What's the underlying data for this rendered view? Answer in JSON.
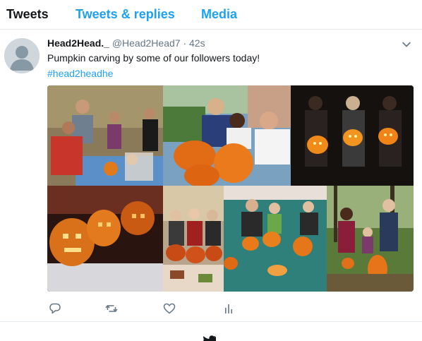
{
  "tabs": {
    "tweets": "Tweets",
    "replies": "Tweets & replies",
    "media": "Media"
  },
  "tweet": {
    "name": "Head2Head._",
    "handle": "@Head2Head7",
    "separator": "·",
    "time": "42s",
    "text": "Pumpkin carving by some of our followers today!",
    "hashtag": "#head2headhe"
  },
  "icons": {
    "avatar": "default-user-icon",
    "menu": "chevron-down-icon",
    "reply": "reply-icon",
    "retweet": "retweet-icon",
    "like": "heart-icon",
    "analytics": "analytics-icon",
    "footer": "twitter-bird-icon"
  },
  "colors": {
    "accent": "#1da1f2",
    "text": "#14171a",
    "muted": "#657786",
    "border": "#e6ecf0"
  }
}
